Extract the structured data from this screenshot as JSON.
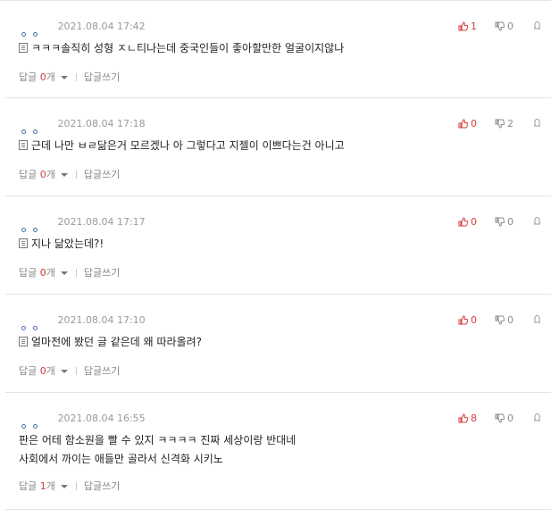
{
  "comments": [
    {
      "date": "2021.08.04 17:42",
      "up": "1",
      "down": "0",
      "lines": [
        "ㅋㅋㅋ솔직히 성형 ㅈㄴ티나는데 중국인들이 좋아할만한 얼굴이지않나"
      ],
      "reply_label": "답글",
      "reply_count": "0",
      "reply_unit": "개",
      "write_label": "답글쓰기"
    },
    {
      "date": "2021.08.04 17:18",
      "up": "0",
      "down": "2",
      "lines": [
        "근데 나만 ㅂㄹ닮은거 모르겠나 아 그렇다고 지젤이 이쁘다는건 아니고"
      ],
      "reply_label": "답글",
      "reply_count": "0",
      "reply_unit": "개",
      "write_label": "답글쓰기"
    },
    {
      "date": "2021.08.04 17:17",
      "up": "0",
      "down": "0",
      "lines": [
        "지나 닮았는데?!"
      ],
      "reply_label": "답글",
      "reply_count": "0",
      "reply_unit": "개",
      "write_label": "답글쓰기"
    },
    {
      "date": "2021.08.04 17:10",
      "up": "0",
      "down": "0",
      "lines": [
        "얼마전에 봤던 글 같은데 왜 따라올려?"
      ],
      "reply_label": "답글",
      "reply_count": "0",
      "reply_unit": "개",
      "write_label": "답글쓰기"
    },
    {
      "date": "2021.08.04 16:55",
      "up": "8",
      "down": "0",
      "lines": [
        "판은 어테 함소원을 빨 수 있지 ㅋㅋㅋㅋ 진짜 세상이랑 반대네",
        "사회에서 까이는 애들만 골라서 신격화 시키노"
      ],
      "reply_label": "답글",
      "reply_count": "1",
      "reply_unit": "개",
      "write_label": "답글쓰기"
    }
  ],
  "colors": {
    "accent_red": "#d83b3b",
    "meta_gray": "#9a9a9a",
    "author_blue": "#4a6fa5"
  }
}
